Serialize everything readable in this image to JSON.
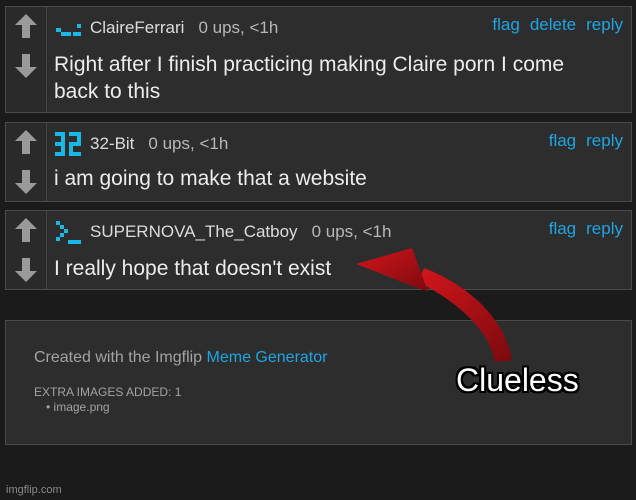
{
  "comments": [
    {
      "username": "ClaireFerrari",
      "meta": "0 ups, <1h",
      "actions": [
        "flag",
        "delete",
        "reply"
      ],
      "text": "Right after I finish practicing making Claire porn I come back to this"
    },
    {
      "username": "32-Bit",
      "meta": "0 ups, <1h",
      "actions": [
        "flag",
        "reply"
      ],
      "text": "i am going to make that a website"
    },
    {
      "username": "SUPERNOVA_The_Catboy",
      "meta": "0 ups, <1h",
      "actions": [
        "flag",
        "reply"
      ],
      "text": "I really hope that doesn't exist"
    }
  ],
  "footer": {
    "created_prefix": "Created with the Imgflip",
    "created_link": "Meme Generator",
    "extra_images": "EXTRA IMAGES ADDED: 1",
    "image_item": "image.png"
  },
  "caption": "Clueless",
  "watermark": "imgflip.com",
  "colors": {
    "background": "#1b1b1b",
    "card": "#2d2d2d",
    "link": "#1ea5e4",
    "avatar_cyan": "#19b9e6",
    "arrow_red": "#b01015"
  }
}
